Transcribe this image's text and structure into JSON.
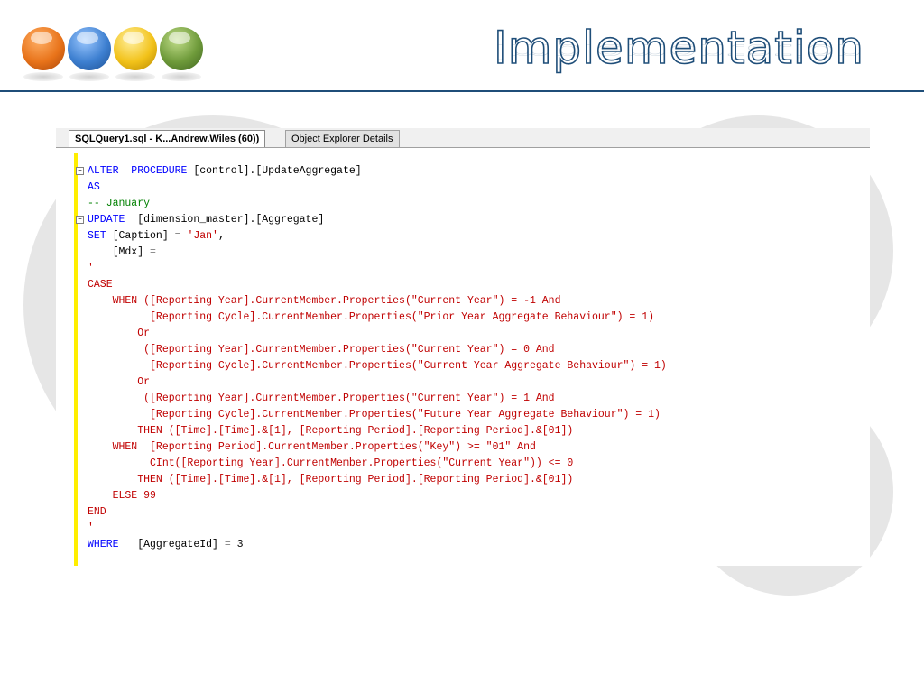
{
  "slide": {
    "title": "Implementation",
    "colors": {
      "title_stroke": "#1f4e79",
      "rule": "#1f4e79"
    },
    "balls": [
      {
        "name": "orange-ball",
        "color": "#e8731a"
      },
      {
        "name": "blue-ball",
        "color": "#3d7fd0"
      },
      {
        "name": "yellow-ball",
        "color": "#f2c21a"
      },
      {
        "name": "green-ball",
        "color": "#6e9a3a"
      }
    ]
  },
  "window": {
    "tabs": [
      {
        "label": "SQLQuery1.sql - K...Andrew.Wiles (60))",
        "active": true
      },
      {
        "label": "Object Explorer Details",
        "active": false
      }
    ]
  },
  "code": {
    "lines": [
      "ALTER  PROCEDURE [control].[UpdateAggregate]",
      "AS",
      "-- January",
      "UPDATE  [dimension_master].[Aggregate]",
      "SET [Caption] = 'Jan',",
      "    [Mdx] =",
      "'",
      "CASE",
      "    WHEN ([Reporting Year].CurrentMember.Properties(\"Current Year\") = -1 And",
      "          [Reporting Cycle].CurrentMember.Properties(\"Prior Year Aggregate Behaviour\") = 1)",
      "        Or",
      "         ([Reporting Year].CurrentMember.Properties(\"Current Year\") = 0 And",
      "          [Reporting Cycle].CurrentMember.Properties(\"Current Year Aggregate Behaviour\") = 1)",
      "        Or",
      "         ([Reporting Year].CurrentMember.Properties(\"Current Year\") = 1 And",
      "          [Reporting Cycle].CurrentMember.Properties(\"Future Year Aggregate Behaviour\") = 1)",
      "        THEN ([Time].[Time].&[1], [Reporting Period].[Reporting Period].&[01])",
      "    WHEN  [Reporting Period].CurrentMember.Properties(\"Key\") >= \"01\" And",
      "          CInt([Reporting Year].CurrentMember.Properties(\"Current Year\")) <= 0",
      "        THEN ([Time].[Time].&[1], [Reporting Period].[Reporting Period].&[01])",
      "    ELSE 99",
      "END",
      "'",
      "WHERE   [AggregateId] = 3"
    ]
  }
}
